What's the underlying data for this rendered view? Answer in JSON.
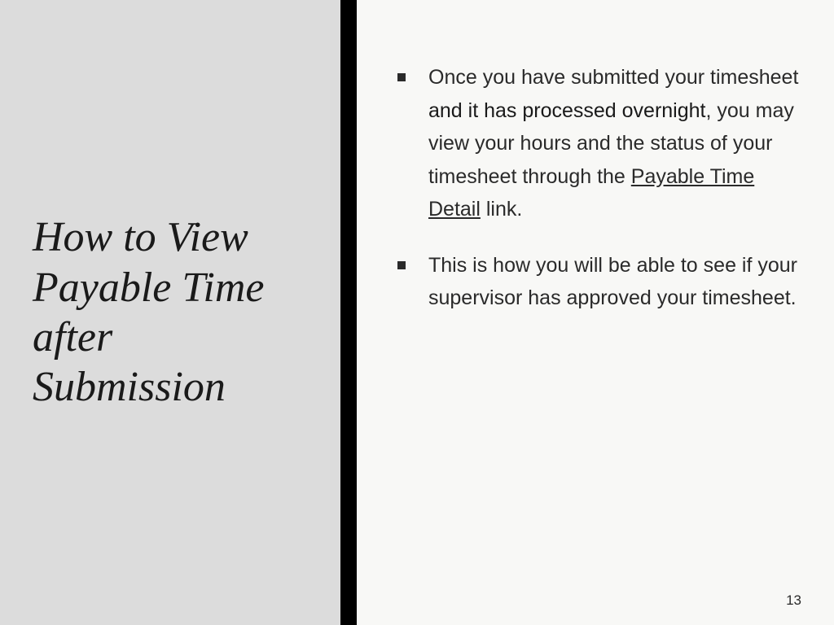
{
  "title": "How to View Payable Time after Submission",
  "bullets": [
    {
      "pre": "Once you have submitted your timesheet ",
      "bold": "and it has processed overnight",
      "mid": ", you may view your hours and the status of your timesheet through the ",
      "link": "Payable Time Detail",
      "post": " link."
    },
    {
      "text": "This is how you will be able to see if your supervisor has approved your timesheet."
    }
  ],
  "page_number": "13"
}
